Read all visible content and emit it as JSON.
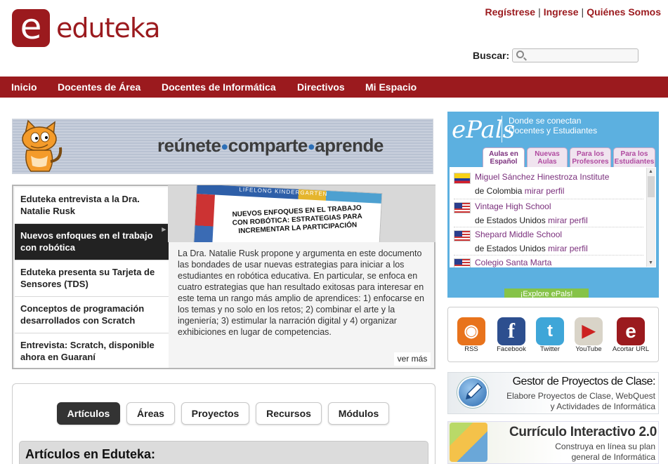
{
  "brand": {
    "logo_letter": "e",
    "name": "eduteka"
  },
  "top_links": [
    "Regístrese",
    "Ingrese",
    "Quiénes Somos"
  ],
  "search": {
    "label": "Buscar:",
    "placeholder": ""
  },
  "nav": [
    "Inicio",
    "Docentes de Área",
    "Docentes de Informática",
    "Directivos",
    "Mi Espacio"
  ],
  "banner": {
    "words": [
      "reúnete",
      "comparte",
      "aprende"
    ]
  },
  "featured": {
    "items": [
      "Eduteka entrevista a la Dra. Natalie Rusk",
      "Nuevos enfoques en el trabajo con robótica",
      "Eduteka presenta su Tarjeta de Sensores (TDS)",
      "Conceptos de programación desarrollados con Scratch",
      "Entrevista: Scratch, disponible ahora en Guaraní"
    ],
    "active_index": 1,
    "image_strip": "LIFELONG KINDERGARTEN",
    "image_title": "NUEVOS ENFOQUES EN EL TRABAJO CON ROBÓTICA: ESTRATEGIAS PARA INCREMENTAR LA PARTICIPACIÓN",
    "description": "La Dra. Natalie Rusk propone y argumenta en este documento las bondades de usar nuevas estrategias para iniciar a los estudiantes en robótica educativa. En particular, se enfoca en cuatro estrategias que han resultado exitosas para interesar en este tema un rango más amplio de aprendices: 1) enfocarse en los temas y no solo en los retos; 2) combinar el arte y la ingeniería; 3) estimular la narración digital y 4) organizar exhibiciones en lugar de competencias.",
    "more": "ver más"
  },
  "content_tabs": [
    "Artículos",
    "Áreas",
    "Proyectos",
    "Recursos",
    "Módulos"
  ],
  "articles_header": "Artículos en Eduteka:",
  "epals": {
    "logo": "ePals",
    "tagline_1": "Donde se conectan",
    "tagline_2": "Docentes y Estudiantes",
    "tabs": [
      {
        "line1": "Aulas en",
        "line2": "Español"
      },
      {
        "line1": "Nuevas",
        "line2": "Aulas"
      },
      {
        "line1": "Para los",
        "line2": "Profesores"
      },
      {
        "line1": "Para los",
        "line2": "Estudiantes"
      }
    ],
    "schools": [
      {
        "name": "Miguel Sánchez Hinestroza Institute",
        "location": "de Colombia",
        "link": "mirar perfil",
        "flag": "co"
      },
      {
        "name": "Vintage High School",
        "location": "de Estados Unidos",
        "link": "mirar perfil",
        "flag": "us"
      },
      {
        "name": "Shepard Middle School",
        "location": "de Estados Unidos",
        "link": "mirar perfil",
        "flag": "us"
      },
      {
        "name": "Colegio Santa Marta",
        "location": "",
        "link": "",
        "flag": "us"
      }
    ],
    "explore": "¡Explore ePals!"
  },
  "social": [
    {
      "label": "RSS",
      "icon": "rss-icon",
      "glyph": "◉",
      "color": "#e8731c"
    },
    {
      "label": "Facebook",
      "icon": "facebook-icon",
      "glyph": "f",
      "color": "#2d4f8f"
    },
    {
      "label": "Twitter",
      "icon": "twitter-icon",
      "glyph": "t",
      "color": "#3fa6d8"
    },
    {
      "label": "YouTube",
      "icon": "youtube-icon",
      "glyph": "▶",
      "color": "#d9d4c8"
    },
    {
      "label": "Acortar URL",
      "icon": "eduteka-url-icon",
      "glyph": "e",
      "color": "#9b1a1e"
    }
  ],
  "gestor": {
    "title": "Gestor de Proyectos de Clase:",
    "line1": "Elabore Proyectos de Clase, WebQuest",
    "line2": "y Actividades de Informática"
  },
  "curriculo": {
    "title": "Currículo Interactivo 2.0",
    "line1": "Construya en línea su plan",
    "line2": "general de Informática"
  },
  "colors": {
    "brand": "#9b1a1e",
    "epals_blue": "#5cb0e0",
    "epals_purple": "#7a2f7c"
  }
}
